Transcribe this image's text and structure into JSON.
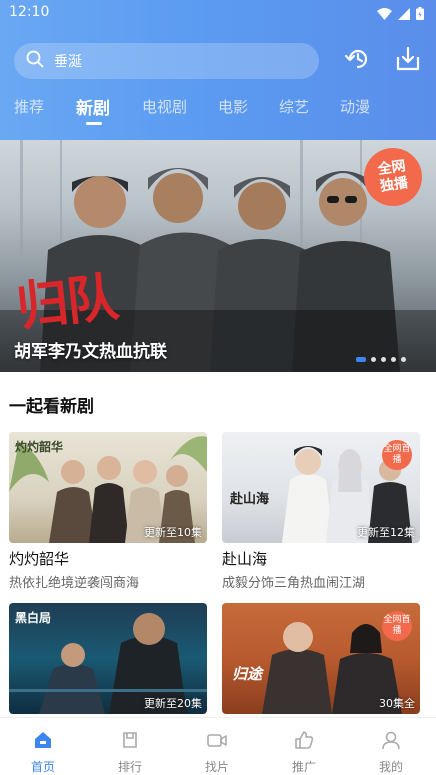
{
  "status_bar": {
    "time": "12:10"
  },
  "search": {
    "text": "垂涎"
  },
  "tabs": [
    {
      "label": "推荐"
    },
    {
      "label": "新剧"
    },
    {
      "label": "电视剧"
    },
    {
      "label": "电影"
    },
    {
      "label": "综艺"
    },
    {
      "label": "动漫"
    }
  ],
  "active_tab": "新剧",
  "banner": {
    "badge_line1": "全网",
    "badge_line2": "独播",
    "logo_text": "归队",
    "caption": "胡军李乃文热血抗联",
    "slide_count": 5,
    "active_slide": 1
  },
  "section": {
    "title": "一起看新剧"
  },
  "cards": [
    {
      "title": "灼灼韶华",
      "subtitle": "热依扎绝境逆袭闯商海",
      "badge": "更新至10集",
      "poster_text": "灼灼韶华"
    },
    {
      "title": "赴山海",
      "subtitle": "成毅分饰三角热血闹江湖",
      "badge": "更新至12集",
      "poster_text": "赴山海",
      "corner_badge": "全网首播"
    },
    {
      "title": "",
      "subtitle": "",
      "badge": "更新至20集",
      "poster_text": "黑白局"
    },
    {
      "title": "",
      "subtitle": "",
      "badge": "30集全",
      "poster_text": "归途",
      "corner_badge": "全网首播"
    }
  ],
  "bottom_nav": [
    {
      "label": "首页",
      "icon": "home-icon",
      "active": true
    },
    {
      "label": "排行",
      "icon": "ranking-icon",
      "active": false
    },
    {
      "label": "找片",
      "icon": "video-icon",
      "active": false
    },
    {
      "label": "推广",
      "icon": "thumbs-up-icon",
      "active": false
    },
    {
      "label": "我的",
      "icon": "user-icon",
      "active": false
    }
  ],
  "colors": {
    "accent": "#3d86f0",
    "header_gradient_start": "#6aa8f3",
    "header_gradient_end": "#5a8eea",
    "badge_orange": "#f26a4b"
  }
}
